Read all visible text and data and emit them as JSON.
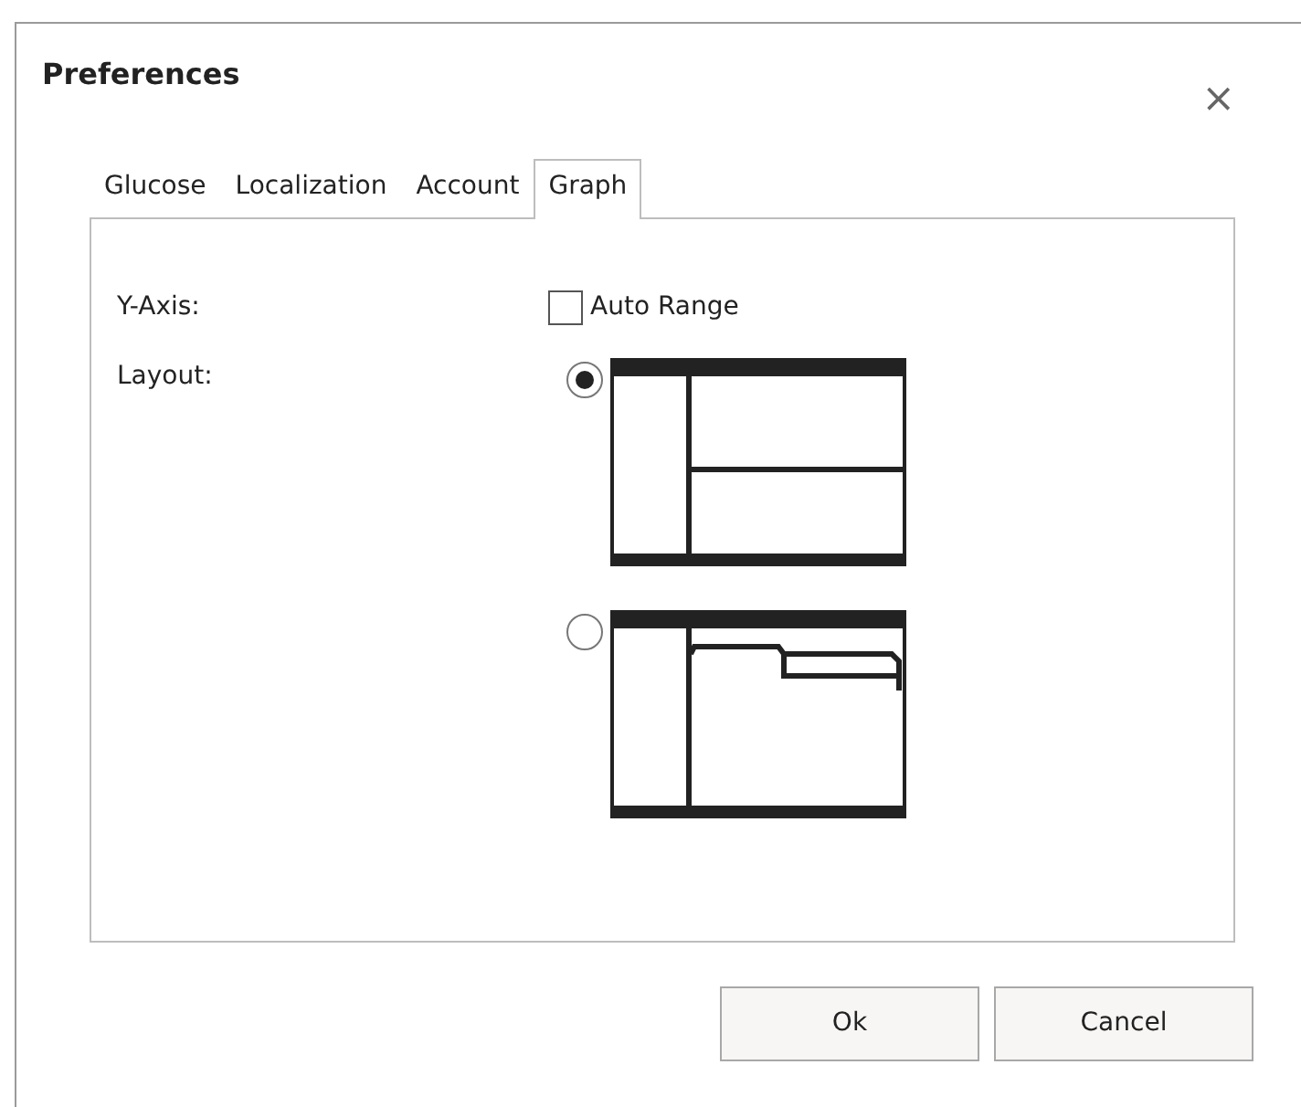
{
  "window": {
    "title": "Preferences",
    "close": "×"
  },
  "tabs": [
    {
      "label": "Glucose",
      "selected": false
    },
    {
      "label": "Localization",
      "selected": false
    },
    {
      "label": "Account",
      "selected": false
    },
    {
      "label": "Graph",
      "selected": true
    }
  ],
  "y_axis": {
    "label": "Y-Axis:",
    "auto_range": {
      "label": "Auto Range",
      "checked": false
    }
  },
  "layout": {
    "label": "Layout:",
    "options": [
      {
        "kind": "split",
        "selected": true
      },
      {
        "kind": "tabbed",
        "selected": false
      }
    ]
  },
  "buttons": [
    "Ok",
    "Cancel"
  ]
}
